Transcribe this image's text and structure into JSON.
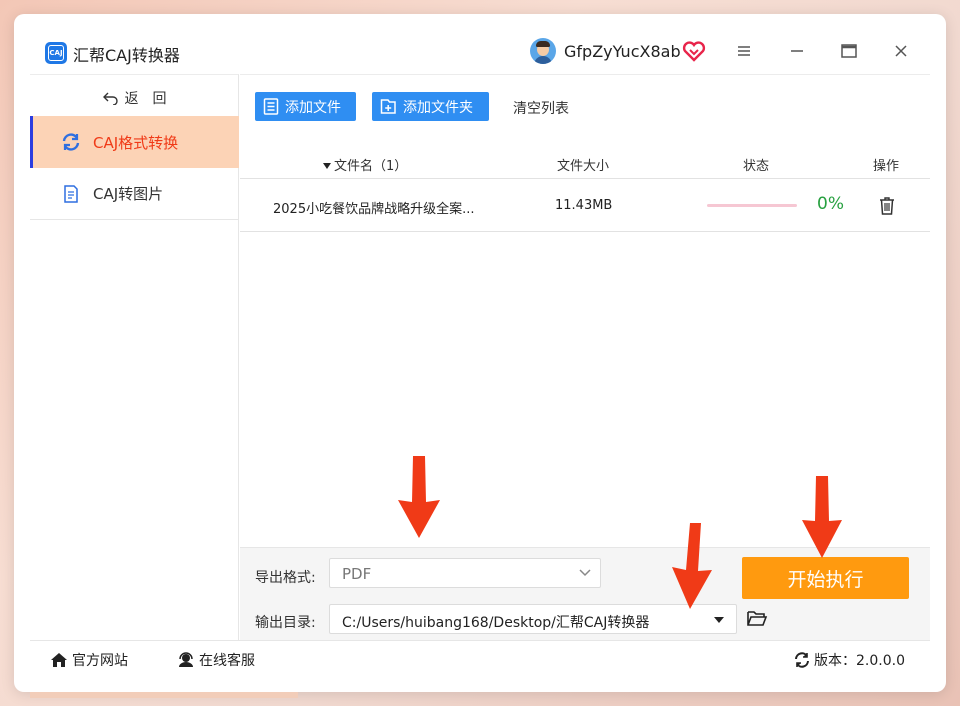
{
  "app": {
    "title": "汇帮CAJ转换器",
    "logo_text": "CAJ",
    "username": "GfpZyYucX8ab",
    "icons": [
      "app-logo-icon",
      "avatar",
      "vip-heart-icon",
      "menu-icon",
      "minimize-icon",
      "maximize-icon",
      "close-icon"
    ]
  },
  "sidebar": {
    "back_label": "返　回",
    "items": [
      {
        "label": "CAJ格式转换",
        "icon": "refresh-icon",
        "active": true
      },
      {
        "label": "CAJ转图片",
        "icon": "document-icon",
        "active": false
      }
    ]
  },
  "toolbar": {
    "add_file": "添加文件",
    "add_folder": "添加文件夹",
    "clear_list": "清空列表"
  },
  "table": {
    "headers": {
      "name": "文件名（1）",
      "size": "文件大小",
      "status": "状态",
      "op": "操作"
    },
    "rows": [
      {
        "name": "2025小吃餐饮品牌战略升级全案...",
        "size": "11.43MB",
        "progress": 0,
        "percent": "0%"
      }
    ]
  },
  "output": {
    "format_label": "导出格式:",
    "format_value": "PDF",
    "dir_label": "输出目录:",
    "dir_value": "C:/Users/huibang168/Desktop/汇帮CAJ转换器",
    "start_label": "开始执行"
  },
  "footer": {
    "site": "官方网站",
    "service": "在线客服",
    "version": "版本：2.0.0.0"
  },
  "colors": {
    "accent_blue": "#2f8ef2",
    "active_bg": "#fcd3b6",
    "active_text": "#f03a17",
    "start_orange": "#ff9a0f",
    "percent_green": "#27a040",
    "arrow_red": "#f03a17"
  }
}
